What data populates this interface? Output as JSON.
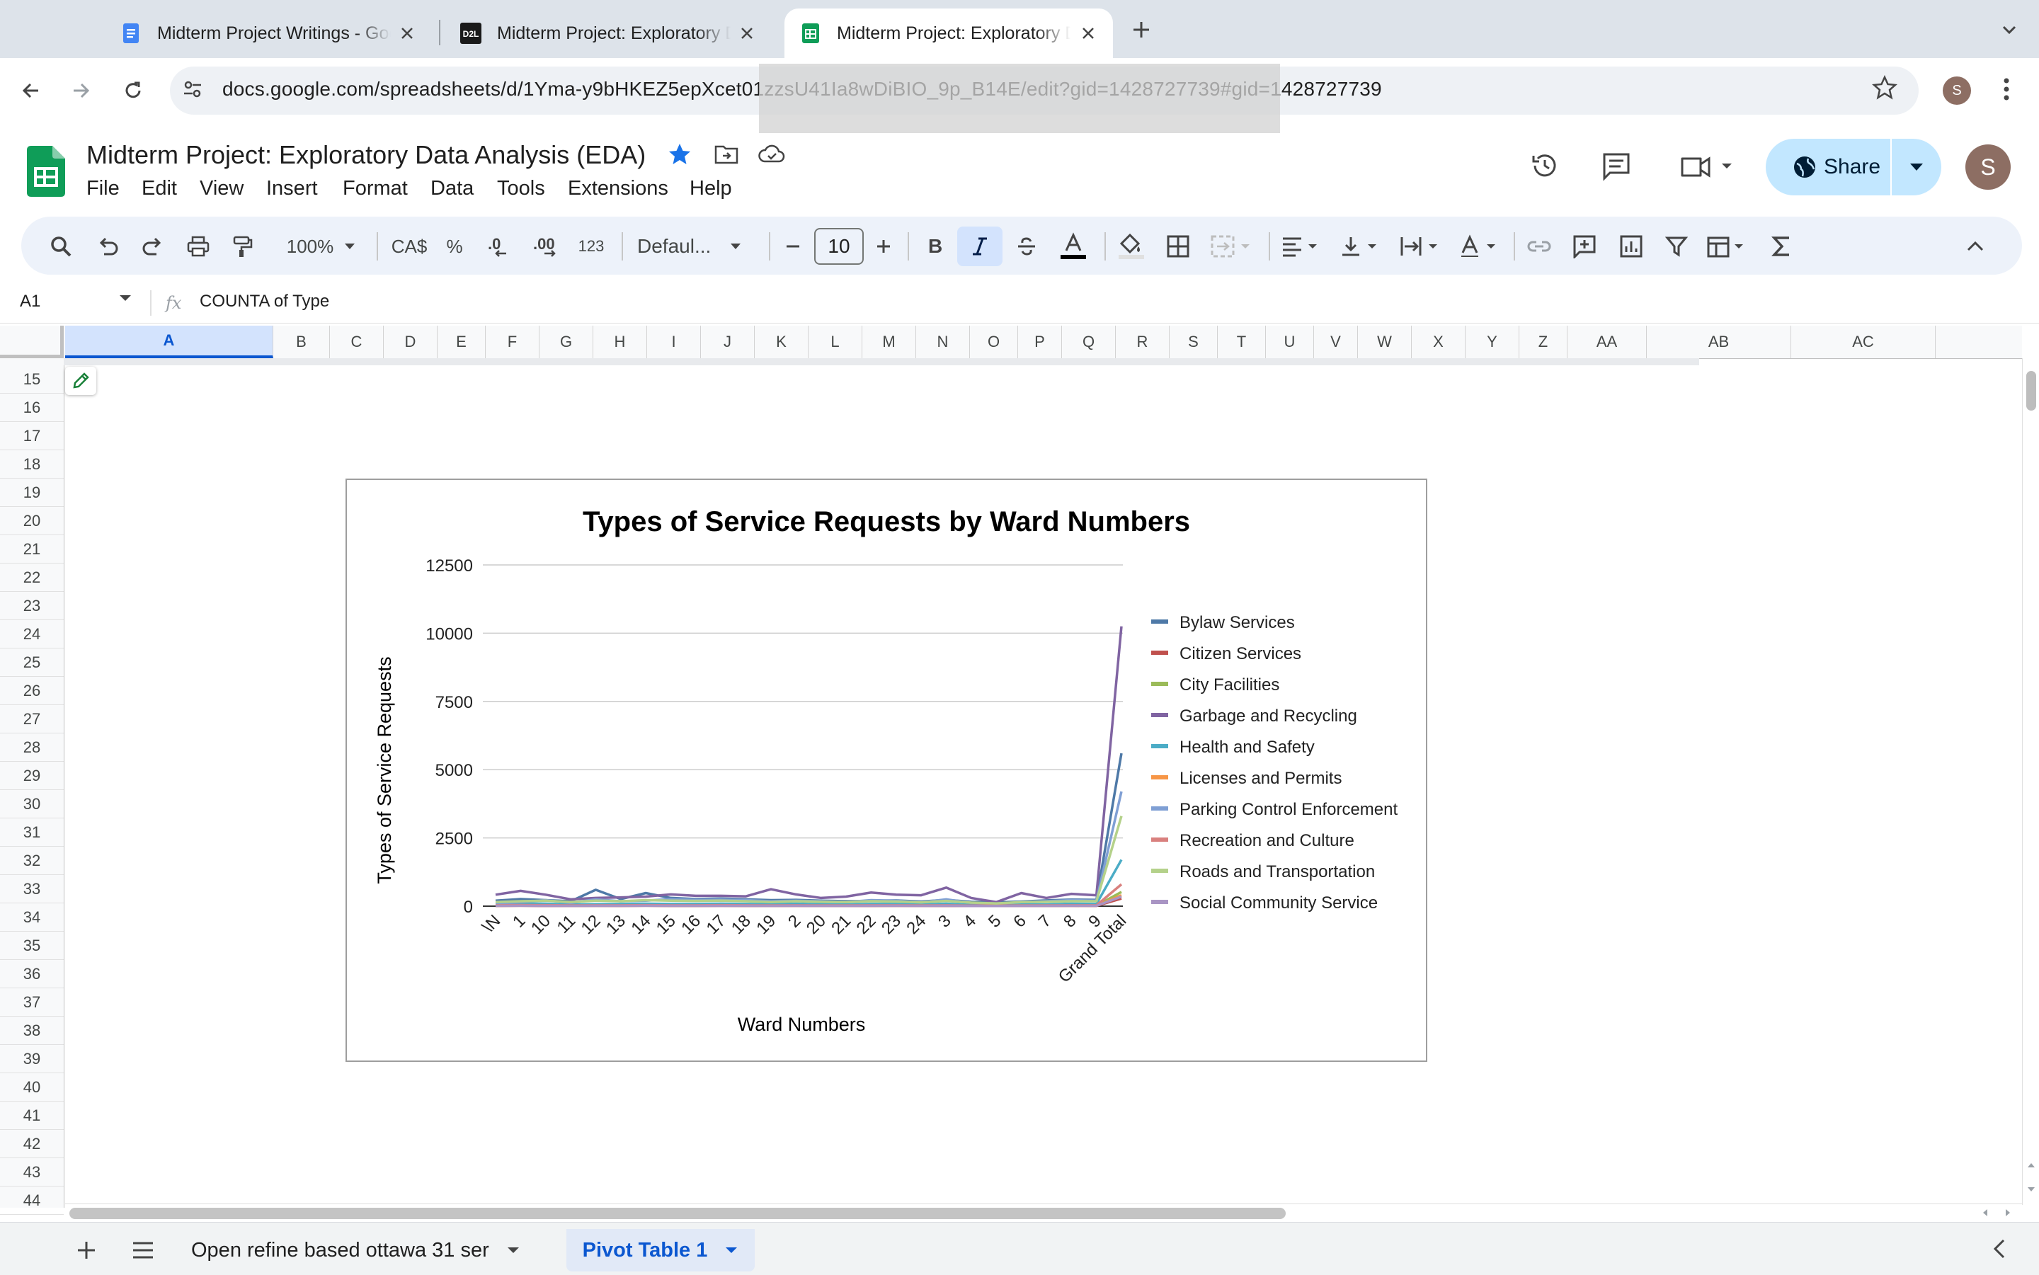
{
  "browser": {
    "tabs": [
      {
        "title": "Midterm Project Writings - Google Docs",
        "favicon": "google-docs-icon",
        "active": false
      },
      {
        "title": "Midterm Project: Exploratory Data Analysis",
        "favicon": "d2l-icon",
        "active": false
      },
      {
        "title": "Midterm Project: Exploratory Data Analysis",
        "favicon": "google-sheets-icon",
        "active": true
      }
    ],
    "url": "docs.google.com/spreadsheets/d/1Yma-y9bHKEZ5epXcet01zzsU41Ia8wDiBIO_9p_B14E/edit?gid=1428727739#gid=1428727739",
    "profile_initial": "S"
  },
  "sheets": {
    "title": "Midterm Project: Exploratory Data Analysis (EDA)",
    "menus": [
      "File",
      "Edit",
      "View",
      "Insert",
      "Format",
      "Data",
      "Tools",
      "Extensions",
      "Help"
    ],
    "share_label": "Share",
    "avatar_initial": "S",
    "toolbar": {
      "zoom": "100%",
      "currency": "CA$",
      "percent": "%",
      "decrease_decimal": ".0",
      "increase_decimal": ".00",
      "number_format": "123",
      "font": "Defaul...",
      "font_size": "10"
    },
    "name_box": "A1",
    "formula": "COUNTA of Type",
    "columns": [
      "A",
      "B",
      "C",
      "D",
      "E",
      "F",
      "G",
      "H",
      "I",
      "J",
      "K",
      "L",
      "M",
      "N",
      "O",
      "P",
      "Q",
      "R",
      "S",
      "T",
      "U",
      "V",
      "W",
      "X",
      "Y",
      "Z",
      "AA",
      "AB",
      "AC"
    ],
    "rows": [
      "15",
      "16",
      "17",
      "18",
      "19",
      "20",
      "21",
      "22",
      "23",
      "24",
      "25",
      "26",
      "27",
      "28",
      "29",
      "30",
      "31",
      "32",
      "33",
      "34",
      "35",
      "36",
      "37",
      "38",
      "39",
      "40",
      "41",
      "42",
      "43",
      "44"
    ],
    "sheet_tabs": [
      {
        "label": "Open refine based ottawa 31 ser",
        "active": false
      },
      {
        "label": "Pivot Table 1",
        "active": true
      }
    ]
  },
  "chart_data": {
    "type": "line",
    "title": "Types of Service Requests by Ward Numbers",
    "xlabel": "Ward Numbers",
    "ylabel": "Types of Service Requests",
    "ylim": [
      0,
      12500
    ],
    "yticks": [
      "12500",
      "10000",
      "7500",
      "5000",
      "2500",
      "0"
    ],
    "ytick_values": [
      12500,
      10000,
      7500,
      5000,
      2500,
      0
    ],
    "grid": true,
    "legend_position": "right",
    "categories": [
      "\\N",
      "1",
      "10",
      "11",
      "12",
      "13",
      "14",
      "15",
      "16",
      "17",
      "18",
      "19",
      "2",
      "20",
      "21",
      "22",
      "23",
      "24",
      "3",
      "4",
      "5",
      "6",
      "7",
      "8",
      "9",
      "Grand Total"
    ],
    "series": [
      {
        "name": "Bylaw Services",
        "color": "#4e79a7",
        "values": [
          200,
          260,
          220,
          180,
          600,
          260,
          480,
          300,
          260,
          280,
          250,
          220,
          230,
          200,
          180,
          190,
          210,
          170,
          230,
          160,
          140,
          170,
          210,
          240,
          230,
          5600
        ]
      },
      {
        "name": "Citizen Services",
        "color": "#c0504d",
        "values": [
          10,
          15,
          10,
          10,
          12,
          10,
          15,
          10,
          10,
          12,
          10,
          10,
          12,
          10,
          10,
          10,
          12,
          10,
          10,
          8,
          8,
          10,
          10,
          12,
          10,
          280
        ]
      },
      {
        "name": "City Facilities",
        "color": "#9bbb59",
        "values": [
          20,
          25,
          20,
          18,
          22,
          20,
          25,
          20,
          20,
          22,
          20,
          18,
          22,
          20,
          18,
          20,
          22,
          18,
          20,
          15,
          15,
          18,
          20,
          22,
          20,
          520
        ]
      },
      {
        "name": "Garbage and Recycling",
        "color": "#8064a2",
        "values": [
          420,
          560,
          420,
          250,
          300,
          320,
          350,
          430,
          380,
          380,
          360,
          620,
          430,
          300,
          350,
          500,
          420,
          400,
          680,
          300,
          150,
          480,
          300,
          450,
          400,
          10250
        ]
      },
      {
        "name": "Health and Safety",
        "color": "#4bacc6",
        "values": [
          80,
          100,
          90,
          60,
          70,
          80,
          90,
          80,
          80,
          90,
          80,
          70,
          90,
          70,
          60,
          80,
          80,
          60,
          90,
          50,
          40,
          70,
          60,
          90,
          80,
          1700
        ]
      },
      {
        "name": "Licenses and Permits",
        "color": "#f79646",
        "values": [
          15,
          20,
          18,
          12,
          15,
          15,
          18,
          15,
          15,
          18,
          15,
          12,
          15,
          12,
          12,
          15,
          15,
          12,
          15,
          10,
          10,
          12,
          12,
          15,
          15,
          400
        ]
      },
      {
        "name": "Parking Control Enforcement",
        "color": "#7f9fd4",
        "values": [
          100,
          150,
          220,
          120,
          250,
          180,
          200,
          260,
          230,
          240,
          220,
          180,
          200,
          180,
          150,
          220,
          200,
          140,
          250,
          120,
          90,
          150,
          180,
          220,
          200,
          4200
        ]
      },
      {
        "name": "Recreation and Culture",
        "color": "#d9807e",
        "values": [
          30,
          40,
          35,
          25,
          30,
          30,
          35,
          30,
          30,
          35,
          30,
          25,
          30,
          25,
          25,
          30,
          30,
          25,
          30,
          20,
          20,
          25,
          25,
          30,
          30,
          800
        ]
      },
      {
        "name": "Roads and Transportation",
        "color": "#b4d18a",
        "values": [
          150,
          180,
          200,
          150,
          200,
          180,
          220,
          200,
          190,
          200,
          180,
          150,
          180,
          160,
          150,
          180,
          170,
          140,
          190,
          130,
          100,
          150,
          160,
          180,
          180,
          3300
        ]
      },
      {
        "name": "Social Community Service",
        "color": "#a995c4",
        "values": [
          12,
          15,
          12,
          10,
          12,
          12,
          15,
          12,
          12,
          14,
          12,
          10,
          12,
          10,
          10,
          12,
          12,
          10,
          12,
          8,
          8,
          10,
          10,
          12,
          12,
          350
        ]
      }
    ]
  }
}
